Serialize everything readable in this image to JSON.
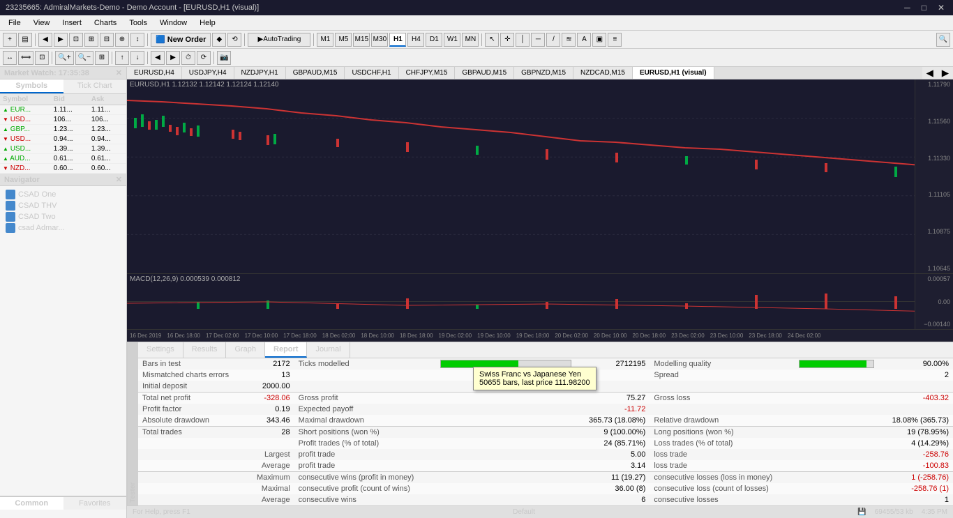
{
  "titleBar": {
    "text": "23235665: AdmiralMarkets-Demo - Demo Account - [EURUSD,H1 (visual)]",
    "controls": [
      "─",
      "□",
      "✕"
    ]
  },
  "menuBar": {
    "items": [
      "File",
      "View",
      "Insert",
      "Charts",
      "Tools",
      "Window",
      "Help"
    ]
  },
  "toolbar1": {
    "newOrder": "New Order",
    "autoTrading": "AutoTrading",
    "timeframes": [
      "M1",
      "M5",
      "M15",
      "M30",
      "H1",
      "H4",
      "D1",
      "W1",
      "MN"
    ]
  },
  "marketWatch": {
    "header": "Market Watch: 17:35:38",
    "tabs": [
      "Symbols",
      "Tick Chart"
    ],
    "columns": [
      "Symbol",
      "Bid",
      "Ask"
    ],
    "rows": [
      {
        "symbol": "EUR...",
        "bid": "1.11...",
        "ask": "1.11...",
        "dir": "up"
      },
      {
        "symbol": "USD...",
        "bid": "106...",
        "ask": "106...",
        "dir": "down"
      },
      {
        "symbol": "GBP...",
        "bid": "1.23...",
        "ask": "1.23...",
        "dir": "up"
      },
      {
        "symbol": "USD...",
        "bid": "0.94...",
        "ask": "0.94...",
        "dir": "down"
      },
      {
        "symbol": "USD...",
        "bid": "1.39...",
        "ask": "1.39...",
        "dir": "up"
      },
      {
        "symbol": "AUD...",
        "bid": "0.61...",
        "ask": "0.61...",
        "dir": "up"
      },
      {
        "symbol": "NZD...",
        "bid": "0.60...",
        "ask": "0.60...",
        "dir": "down"
      }
    ]
  },
  "navigator": {
    "header": "Navigator",
    "items": [
      "CSAD One",
      "CSAD THV",
      "CSAD Two",
      "csad Admar..."
    ],
    "tabs": [
      "Common",
      "Favorites"
    ]
  },
  "chartTabs": [
    "EURUSD,H4",
    "USDJPY,H4",
    "NZDJPY,H1",
    "GBPAUD,M15",
    "USDCHF,H1",
    "CHFJPY,M15",
    "GBPAUD,M15",
    "GBPNZD,M15",
    "NZDCAD,M15",
    "EURUSD,H1 (visual)"
  ],
  "chartHeader": "EURUSD,H1  1.12132  1.12142  1.12124  1.12140",
  "macdHeader": "MACD(12,26,9) 0.000539 0.000812",
  "priceLabels": [
    "1.11790",
    "1.11560",
    "1.11330",
    "1.11105",
    "1.10875",
    "1.10645"
  ],
  "macdLabels": [
    "0.00057",
    "0.00",
    "−0.00140"
  ],
  "timeLabels": [
    "16 Dec 2019",
    "16 Dec 18:00",
    "17 Dec 02:00",
    "17 Dec 10:00",
    "17 Dec 18:00",
    "18 Dec 02:00",
    "18 Dec 10:00",
    "18 Dec 18:00",
    "19 Dec 02:00",
    "19 Dec 10:00",
    "19 Dec 18:00",
    "20 Dec 02:00",
    "20 Dec 10:00",
    "20 Dec 18:00",
    "23 Dec 02:00",
    "23 Dec 10:00",
    "23 Dec 18:00",
    "24 Dec 02:00"
  ],
  "tooltip": {
    "line1": "Swiss Franc vs Japanese Yen",
    "line2": "50655 bars, last price 111.98200"
  },
  "tester": {
    "sideLabel": "Tester",
    "tabs": [
      "Settings",
      "Results",
      "Graph",
      "Report",
      "Journal"
    ],
    "activeTab": "Report",
    "report": {
      "barsInTest": {
        "label": "Bars in test",
        "value": "2172"
      },
      "ticksModelled": {
        "label": "Ticks modelled",
        "value": "2712195"
      },
      "modellingQuality": {
        "label": "Modelling quality",
        "value": "90.00%"
      },
      "modellingQualityBar": 90,
      "mismatchedErrors": {
        "label": "Mismatched charts errors",
        "value": "13"
      },
      "initialDeposit": {
        "label": "Initial deposit",
        "value": "2000.00"
      },
      "spread": {
        "label": "Spread",
        "value": "2"
      },
      "totalNetProfit": {
        "label": "Total net profit",
        "value": "-328.06"
      },
      "grossProfit": {
        "label": "Gross profit",
        "value": "75.27"
      },
      "grossLoss": {
        "label": "Gross loss",
        "value": "-403.32"
      },
      "profitFactor": {
        "label": "Profit factor",
        "value": "0.19"
      },
      "expectedPayoff": {
        "label": "Expected payoff",
        "value": "-11.72"
      },
      "absoluteDrawdown": {
        "label": "Absolute drawdown",
        "value": "343.46"
      },
      "maximalDrawdown": {
        "label": "Maximal drawdown",
        "value": "365.73 (18.08%)"
      },
      "relativeDrawdown": {
        "label": "Relative drawdown",
        "value": "18.08% (365.73)"
      },
      "totalTrades": {
        "label": "Total trades",
        "value": "28"
      },
      "shortPositions": {
        "label": "Short positions (won %)",
        "value": "9 (100.00%)"
      },
      "longPositions": {
        "label": "Long positions (won %)",
        "value": "19 (78.95%)"
      },
      "profitTrades": {
        "label": "Profit trades (% of total)",
        "value": "24 (85.71%)"
      },
      "lossTrades": {
        "label": "Loss trades (% of total)",
        "value": "4 (14.29%)"
      },
      "largestProfitTrade": {
        "label": "profit trade",
        "sublabel": "Largest",
        "value": "5.00"
      },
      "largestLossTrade": {
        "label": "loss trade",
        "value": "-258.76"
      },
      "averageProfitTrade": {
        "label": "profit trade",
        "sublabel": "Average",
        "value": "3.14"
      },
      "averageLossTrade": {
        "label": "loss trade",
        "value": "-100.83"
      },
      "maxConsecWinsMoney": {
        "label": "consecutive wins (profit in money)",
        "sublabel": "Maximum",
        "value": "11 (19.27)"
      },
      "maxConsecLossesMoney": {
        "label": "consecutive losses (loss in money)",
        "value": "1 (-258.76)"
      },
      "maxConsecProfitCount": {
        "label": "consecutive profit (count of wins)",
        "sublabel": "Maximal",
        "value": "36.00 (8)"
      },
      "maxConsecLossCount": {
        "label": "consecutive loss (count of losses)",
        "value": "-258.76 (1)"
      },
      "avgConsecWins": {
        "label": "consecutive wins",
        "sublabel": "Average",
        "value": "6"
      },
      "avgConsecLosses": {
        "label": "consecutive losses",
        "value": "1"
      }
    }
  },
  "statusBar": {
    "help": "For Help, press F1",
    "default": "Default",
    "memory": "69455/53 kb",
    "time": "4:35 PM"
  }
}
